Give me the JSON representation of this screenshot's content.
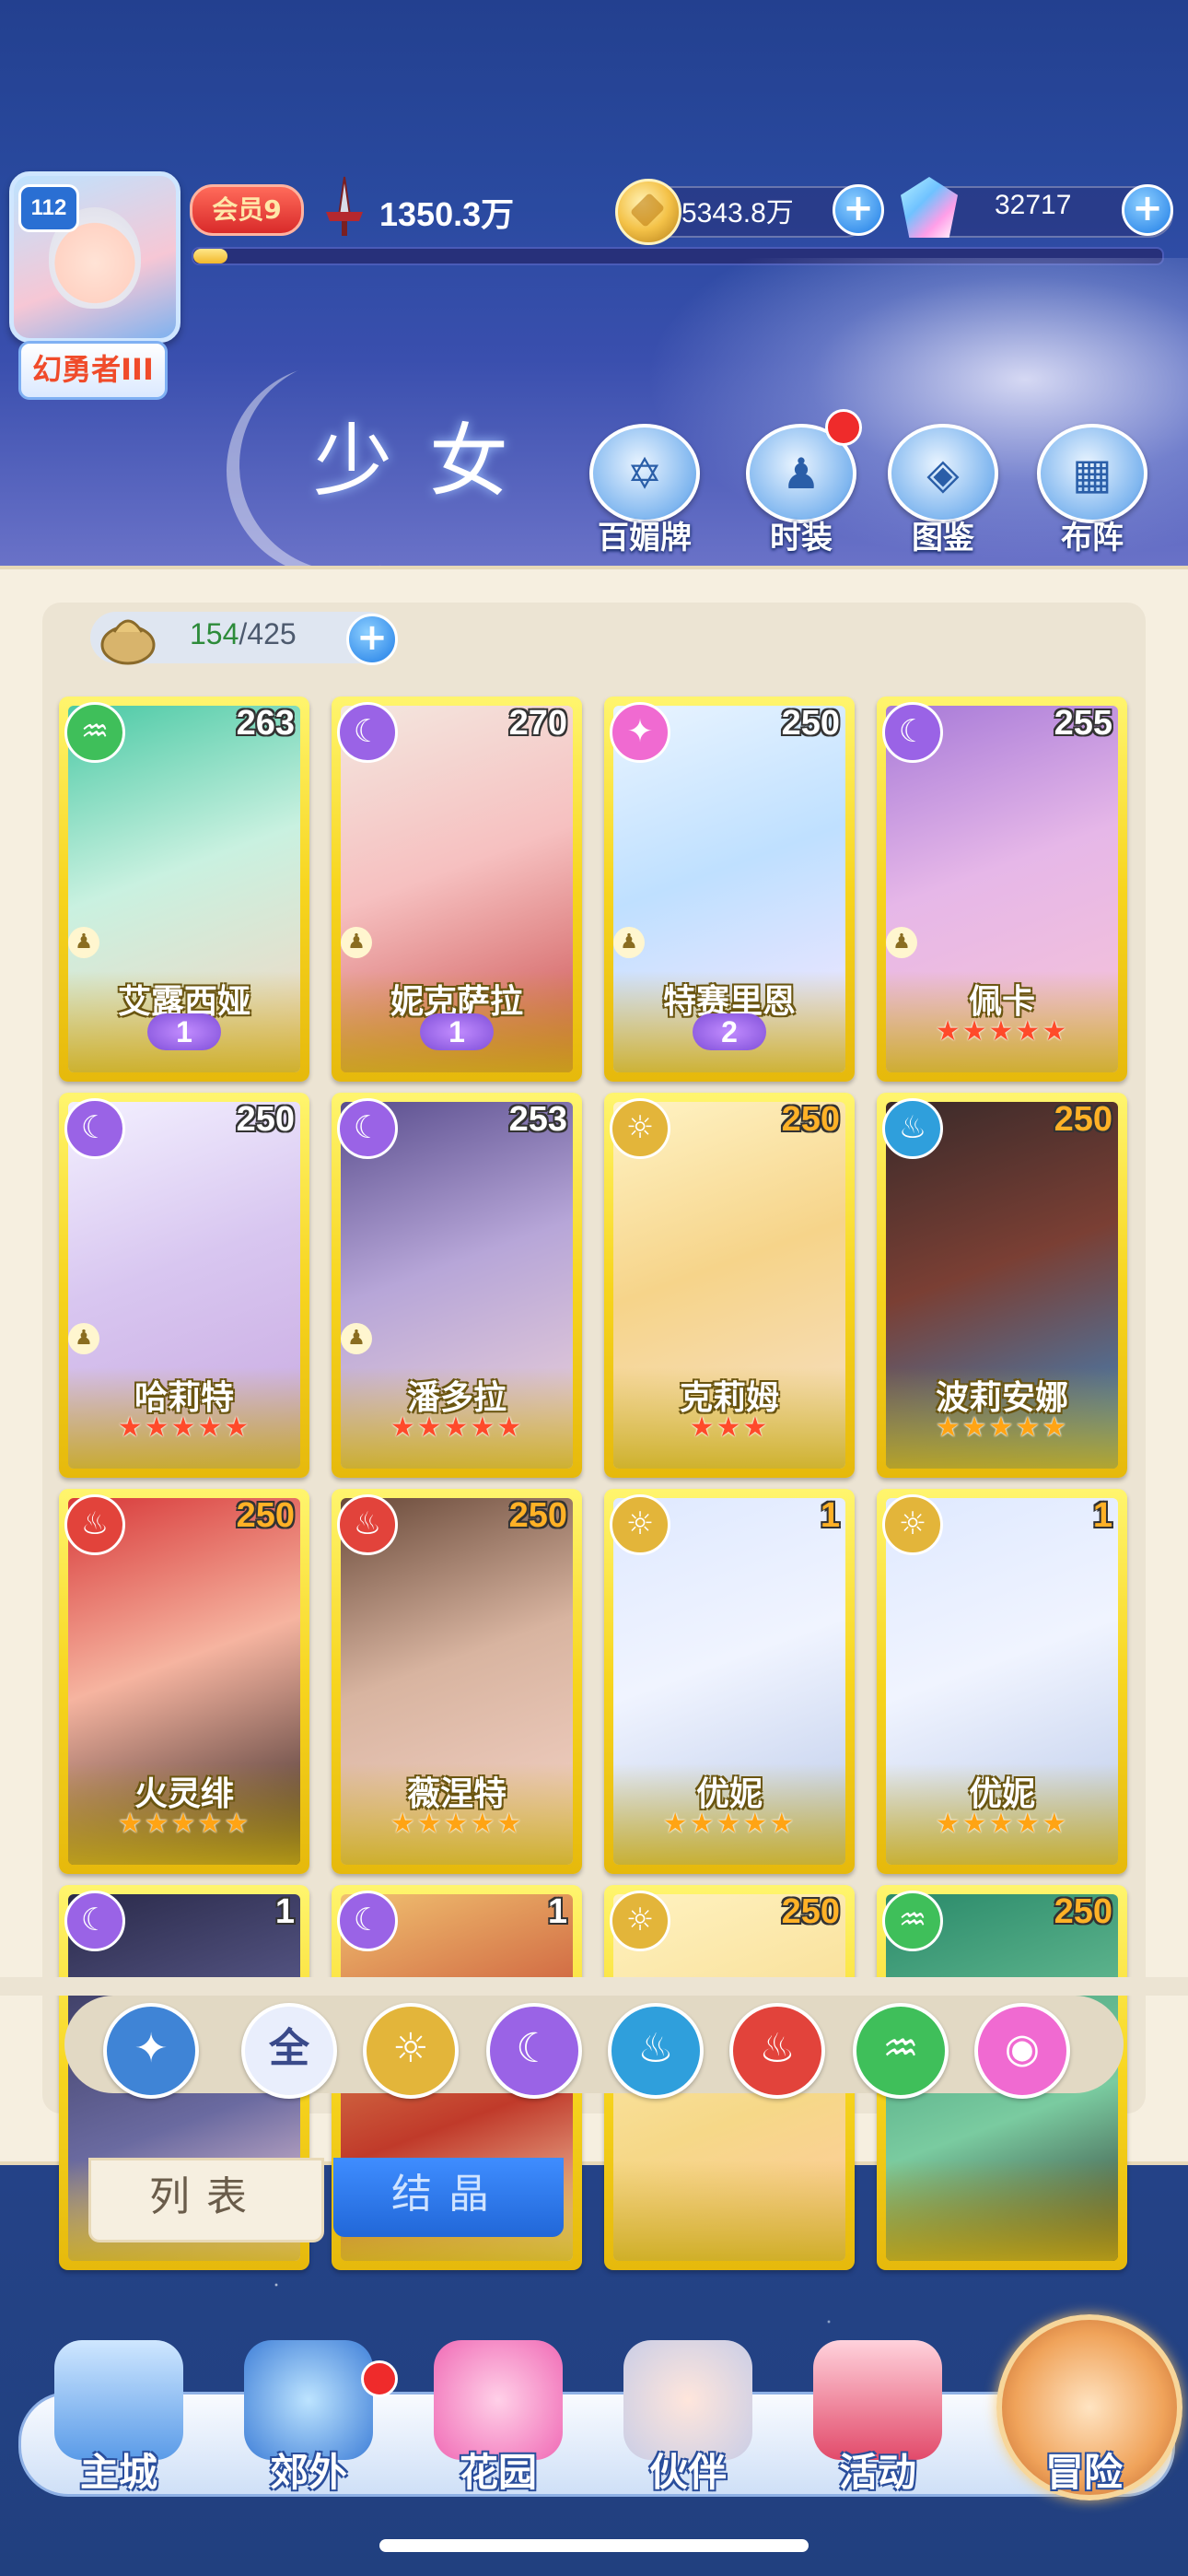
{
  "player": {
    "level": "112",
    "title": "幻勇者III",
    "vip": "会员9",
    "power": "1350.3万",
    "gold": "5343.8万",
    "gems": "32717",
    "exp_progress": 0.035
  },
  "hero": {
    "title": "少女",
    "buttons": [
      {
        "label": "百媚牌",
        "icon": "card-deck-icon"
      },
      {
        "label": "时装",
        "icon": "outfit-icon"
      },
      {
        "label": "图鉴",
        "icon": "book-icon"
      },
      {
        "label": "布阵",
        "icon": "formation-grid-icon"
      }
    ]
  },
  "inventory": {
    "current": "154",
    "max": "425"
  },
  "cards": [
    {
      "name": "艾露西娅",
      "level": "263",
      "element": "wind",
      "awaken": "1",
      "stars": 0
    },
    {
      "name": "妮克萨拉",
      "level": "270",
      "element": "moon",
      "awaken": "1",
      "stars": 0
    },
    {
      "name": "特赛里恩",
      "level": "250",
      "element": "star",
      "awaken": "2",
      "stars": 0
    },
    {
      "name": "佩卡",
      "level": "255",
      "element": "moon",
      "awaken": "",
      "stars": 5
    },
    {
      "name": "哈莉特",
      "level": "250",
      "element": "moon",
      "awaken": "",
      "stars": 5
    },
    {
      "name": "潘多拉",
      "level": "253",
      "element": "moon",
      "awaken": "",
      "stars": 5
    },
    {
      "name": "克莉姆",
      "level": "250",
      "element": "sun",
      "awaken": "",
      "stars": 3
    },
    {
      "name": "波莉安娜",
      "level": "250",
      "element": "water",
      "awaken": "",
      "stars": 5
    },
    {
      "name": "火灵绯",
      "level": "250",
      "element": "fire",
      "awaken": "",
      "stars": 5
    },
    {
      "name": "薇涅特",
      "level": "250",
      "element": "fire",
      "awaken": "",
      "stars": 5
    },
    {
      "name": "优妮",
      "level": "1",
      "element": "sun",
      "awaken": "",
      "stars": 5
    },
    {
      "name": "优妮",
      "level": "1",
      "element": "sun",
      "awaken": "",
      "stars": 5
    },
    {
      "name": "",
      "level": "1",
      "element": "moon",
      "awaken": "",
      "stars": 0
    },
    {
      "name": "",
      "level": "1",
      "element": "moon",
      "awaken": "",
      "stars": 0
    },
    {
      "name": "",
      "level": "250",
      "element": "sun",
      "awaken": "",
      "stars": 0
    },
    {
      "name": "",
      "level": "250",
      "element": "wind",
      "awaken": "",
      "stars": 0
    }
  ],
  "filters": [
    {
      "label": "",
      "icon": "compass-star-icon",
      "color": "#3f84d6"
    },
    {
      "label": "全",
      "icon": "all-icon",
      "color": "#e9eefc"
    },
    {
      "label": "",
      "icon": "sun-element-icon",
      "color": "#e3b53a"
    },
    {
      "label": "",
      "icon": "moon-element-icon",
      "color": "#9a63e6"
    },
    {
      "label": "",
      "icon": "water-element-icon",
      "color": "#2f9fdc"
    },
    {
      "label": "",
      "icon": "fire-element-icon",
      "color": "#e2433b"
    },
    {
      "label": "",
      "icon": "wind-element-icon",
      "color": "#3fbf5a"
    },
    {
      "label": "",
      "icon": "star-element-icon",
      "color": "#f06ad1"
    }
  ],
  "tabs": {
    "list": "列表",
    "crystal": "结晶"
  },
  "nav": [
    {
      "label": "主城",
      "icon": "castle-icon"
    },
    {
      "label": "郊外",
      "icon": "hexagram-icon"
    },
    {
      "label": "花园",
      "icon": "heart-icon"
    },
    {
      "label": "伙伴",
      "icon": "partner-portrait-icon"
    },
    {
      "label": "活动",
      "icon": "gift-box-icon"
    },
    {
      "label": "冒险",
      "icon": "sword-compass-icon"
    }
  ],
  "colors": {
    "element": {
      "wind": "#3fbf5a",
      "moon": "#9a63e6",
      "star": "#f06ad1",
      "sun": "#e3b53a",
      "water": "#2f9fdc",
      "fire": "#e2433b"
    }
  }
}
